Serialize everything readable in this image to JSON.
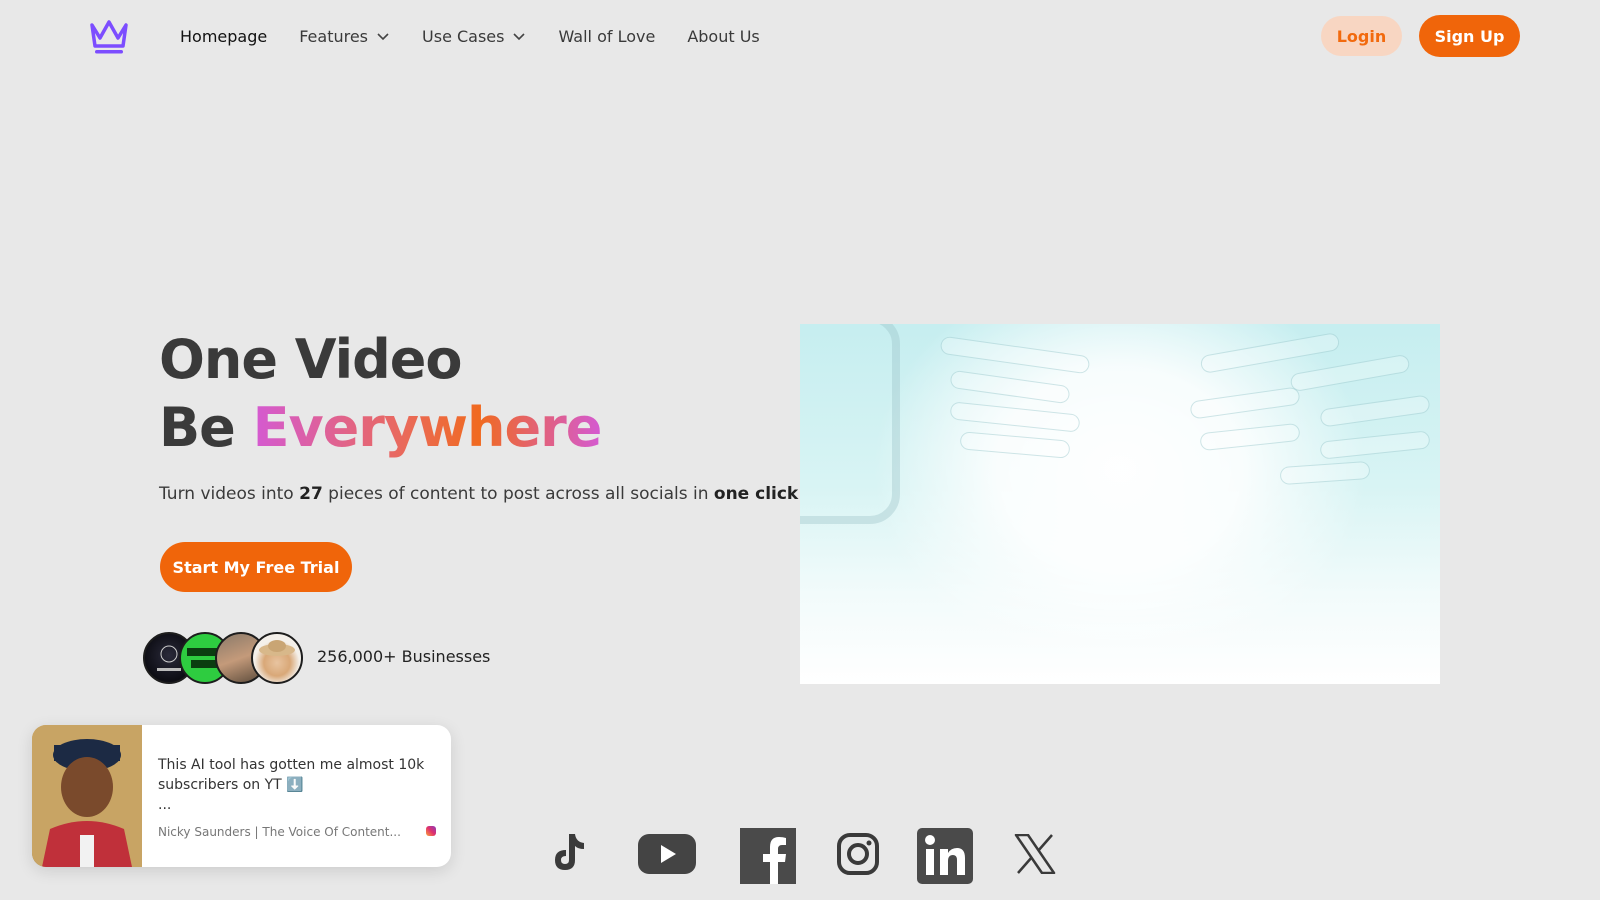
{
  "nav": {
    "logo_icon": "crown-icon",
    "links": [
      {
        "label": "Homepage",
        "dropdown": false
      },
      {
        "label": "Features",
        "dropdown": true
      },
      {
        "label": "Use Cases",
        "dropdown": true
      },
      {
        "label": "Wall of Love",
        "dropdown": false
      },
      {
        "label": "About Us",
        "dropdown": false
      }
    ],
    "login_label": "Login",
    "signup_label": "Sign Up"
  },
  "hero": {
    "title_line1": "One Video",
    "title_line2_prefix": "Be ",
    "title_line2_highlight": "Everywhere",
    "subtitle_part1": "Turn videos into ",
    "subtitle_bold1": "27",
    "subtitle_part2": " pieces of content to post across all socials in ",
    "subtitle_bold2": "one click",
    "cta_label": "Start My Free Trial",
    "social_proof": "256,000+ Businesses"
  },
  "testimonial": {
    "text_line1": "This AI tool has gotten me almost 10k",
    "text_line2": "subscribers on YT ⬇️",
    "text_line3": "...",
    "author": "Nicky Saunders | The Voice Of Content...",
    "source_icon": "instagram-icon"
  },
  "socials": [
    "tiktok-icon",
    "youtube-icon",
    "facebook-icon",
    "instagram-icon",
    "linkedin-icon",
    "x-icon"
  ],
  "colors": {
    "accent": "#f0650a",
    "accent_light": "#f8d6c2",
    "logo": "#7c4dff",
    "background": "#e8e8e8"
  }
}
